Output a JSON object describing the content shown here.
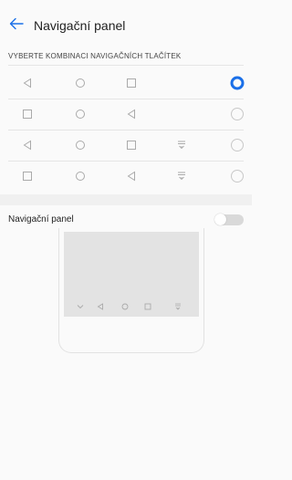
{
  "header": {
    "title": "Navigační panel",
    "back_icon": "arrow-left-icon"
  },
  "section": {
    "label": "VYBERTE KOMBINACI NAVIGAČNÍCH TLAČÍTEK"
  },
  "options": [
    {
      "buttons": [
        "back-icon",
        "home-icon",
        "recent-icon"
      ],
      "selected": true
    },
    {
      "buttons": [
        "recent-icon",
        "home-icon",
        "back-icon"
      ],
      "selected": false
    },
    {
      "buttons": [
        "back-icon",
        "home-icon",
        "recent-icon",
        "notification-pull-icon"
      ],
      "selected": false
    },
    {
      "buttons": [
        "recent-icon",
        "home-icon",
        "back-icon",
        "notification-pull-icon"
      ],
      "selected": false
    }
  ],
  "toggle": {
    "label": "Navigační panel",
    "enabled": false
  },
  "preview": {
    "buttons": [
      "hide-icon",
      "back-icon",
      "home-icon",
      "recent-icon",
      "notification-pull-icon"
    ]
  },
  "colors": {
    "accent": "#1a6fe8",
    "icon_gray": "#aaaaaa",
    "toggle_off": "#d9d9d9"
  }
}
